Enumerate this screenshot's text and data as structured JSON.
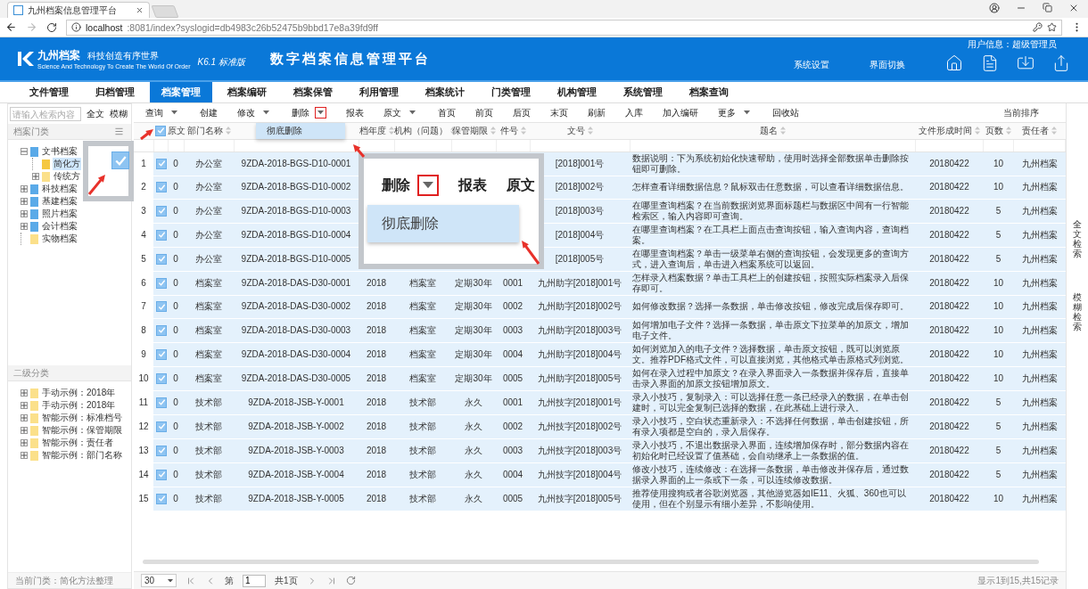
{
  "browser": {
    "tab_title": "九州档案信息管理平台",
    "url_host": "localhost",
    "url_path": ":8081/index?syslogid=db4983c26b52475b9bbd17e8a39fd9ff"
  },
  "header": {
    "logo_name": "九州档案",
    "logo_slogan": "科技创造有序世界",
    "logo_english": "Science And Technology To Create The World Of Order",
    "version": "K6.1 标准版",
    "title": "数字档案信息管理平台",
    "user_info": "用户信息：超级管理员",
    "links": [
      "系统设置",
      "界面切换"
    ]
  },
  "nav": [
    {
      "label": "文件管理",
      "selected": false
    },
    {
      "label": "归档管理",
      "selected": false
    },
    {
      "label": "档案管理",
      "selected": true
    },
    {
      "label": "档案编研",
      "selected": false
    },
    {
      "label": "档案保管",
      "selected": false
    },
    {
      "label": "利用管理",
      "selected": false
    },
    {
      "label": "档案统计",
      "selected": false
    },
    {
      "label": "门类管理",
      "selected": false
    },
    {
      "label": "机构管理",
      "selected": false
    },
    {
      "label": "系统管理",
      "selected": false
    },
    {
      "label": "档案查询",
      "selected": false
    }
  ],
  "search": {
    "placeholder": "请输入检索内容",
    "buttons": [
      "全文",
      "模糊"
    ]
  },
  "category_panel": {
    "title": "档案门类",
    "tree": [
      {
        "label": "文书档案",
        "color": "#5aaae8",
        "kind": "branch",
        "expanded": true,
        "selected": false,
        "children": [
          {
            "label": "简化方",
            "color": "#f5c842",
            "kind": "leaf",
            "selected": true
          },
          {
            "label": "传统方",
            "color": "#fbe08a",
            "kind": "branch",
            "expanded": false,
            "selected": false
          }
        ]
      },
      {
        "label": "科技档案",
        "color": "#5aaae8",
        "kind": "branch",
        "expanded": false,
        "selected": false
      },
      {
        "label": "基建档案",
        "color": "#5aaae8",
        "kind": "branch",
        "expanded": false,
        "selected": false
      },
      {
        "label": "照片档案",
        "color": "#5aaae8",
        "kind": "branch",
        "expanded": false,
        "selected": false
      },
      {
        "label": "会计档案",
        "color": "#5aaae8",
        "kind": "branch",
        "expanded": false,
        "selected": false
      },
      {
        "label": "实物档案",
        "color": "#fbe08a",
        "kind": "leaf",
        "selected": false
      }
    ]
  },
  "secondary_panel": {
    "title": "二级分类",
    "items": [
      {
        "label": "手动示例：2018年",
        "expanded": false
      },
      {
        "label": "手动示例：2018年",
        "expanded": false
      },
      {
        "label": "智能示例：标准档号",
        "expanded": false
      },
      {
        "label": "智能示例：保管期限",
        "expanded": false
      },
      {
        "label": "智能示例：责任者",
        "expanded": false
      },
      {
        "label": "智能示例：部门名称",
        "expanded": false
      }
    ]
  },
  "status": "当前门类：简化方法整理",
  "toolbar": [
    {
      "label": "查询",
      "dropdown": true,
      "highlighted": false
    },
    {
      "label": "创建",
      "dropdown": false,
      "highlighted": false
    },
    {
      "label": "修改",
      "dropdown": true,
      "highlighted": false
    },
    {
      "label": "删除",
      "dropdown": true,
      "highlighted": true
    },
    {
      "label": "报表",
      "dropdown": false,
      "highlighted": false
    },
    {
      "label": "原文",
      "dropdown": true,
      "highlighted": false
    },
    {
      "label": "首页",
      "dropdown": false,
      "highlighted": false
    },
    {
      "label": "前页",
      "dropdown": false,
      "highlighted": false
    },
    {
      "label": "后页",
      "dropdown": false,
      "highlighted": false
    },
    {
      "label": "末页",
      "dropdown": false,
      "highlighted": false
    },
    {
      "label": "刷新",
      "dropdown": false,
      "highlighted": false
    },
    {
      "label": "入库",
      "dropdown": false,
      "highlighted": false
    },
    {
      "label": "加入编研",
      "dropdown": false,
      "highlighted": false
    },
    {
      "label": "更多",
      "dropdown": true,
      "highlighted": false
    },
    {
      "label": "回收站",
      "dropdown": false,
      "highlighted": false
    }
  ],
  "sort_label": "当前排序",
  "delete_menu": {
    "items": [
      "彻底删除"
    ]
  },
  "table": {
    "all_checked": true,
    "columns": [
      {
        "label": "原文",
        "sortable": false
      },
      {
        "label": "部门名称",
        "sortable": true
      },
      null,
      {
        "label": "档年度",
        "sortable": true
      },
      {
        "label": "机构（问题）",
        "sortable": true
      },
      {
        "label": "保管期限",
        "sortable": true
      },
      {
        "label": "件号",
        "sortable": true
      },
      {
        "label": "文号",
        "sortable": true
      },
      {
        "label": "题名",
        "sortable": true
      },
      {
        "label": "文件形成时间",
        "sortable": true
      },
      {
        "label": "页数",
        "sortable": true
      },
      {
        "label": "责任者",
        "sortable": true
      }
    ],
    "rows": [
      {
        "number": "1",
        "checked": true,
        "cells": [
          "0",
          "办公室",
          "9ZDA-2018-BGS-D10-0001",
          null,
          null,
          null,
          null,
          "[2018]001号",
          "数据说明：下为系统初始化快速帮助，使用时选择全部数据单击删除按钮即可删除。",
          "20180422",
          "10",
          "九州档案"
        ]
      },
      {
        "number": "2",
        "checked": true,
        "cells": [
          "0",
          "办公室",
          "9ZDA-2018-BGS-D10-0002",
          null,
          null,
          null,
          null,
          "[2018]002号",
          "怎样查看详细数据信息？鼠标双击任意数据，可以查看详细数据信息。",
          "20180422",
          "10",
          "九州档案"
        ]
      },
      {
        "number": "3",
        "checked": true,
        "cells": [
          "0",
          "办公室",
          "9ZDA-2018-BGS-D10-0003",
          null,
          null,
          null,
          null,
          "[2018]003号",
          "在哪里查询档案？在当前数据浏览界面标题栏与数据区中间有一行智能检索区，输入内容即可查询。",
          "20180422",
          "5",
          "九州档案"
        ]
      },
      {
        "number": "4",
        "checked": true,
        "cells": [
          "0",
          "办公室",
          "9ZDA-2018-BGS-D10-0004",
          null,
          null,
          null,
          null,
          "[2018]004号",
          "在哪里查询档案？在工具栏上面点击查询按钮，输入查询内容，查询档案。",
          "20180422",
          "5",
          "九州档案"
        ]
      },
      {
        "number": "5",
        "checked": true,
        "cells": [
          "0",
          "办公室",
          "9ZDA-2018-BGS-D10-0005",
          null,
          null,
          null,
          null,
          "[2018]005号",
          "在哪里查询档案？单击一级菜单右侧的查询按钮，会发现更多的查询方式，进入查询后，单击进入档案系统可以返回。",
          "20180422",
          "5",
          "九州档案"
        ]
      },
      {
        "number": "6",
        "checked": true,
        "cells": [
          "0",
          "档案室",
          "9ZDA-2018-DAS-D30-0001",
          "2018",
          "档案室",
          "定期30年",
          "0001",
          "九州助字[2018]001号",
          "怎样录入档案数据？单击工具栏上的创建按钮，按照实际档案录入后保存即可。",
          "20180422",
          "10",
          "九州档案"
        ]
      },
      {
        "number": "7",
        "checked": true,
        "cells": [
          "0",
          "档案室",
          "9ZDA-2018-DAS-D30-0002",
          "2018",
          "档案室",
          "定期30年",
          "0002",
          "九州助字[2018]002号",
          "如何修改数据？选择一条数据，单击修改按钮，修改完成后保存即可。",
          "20180422",
          "10",
          "九州档案"
        ]
      },
      {
        "number": "8",
        "checked": true,
        "cells": [
          "0",
          "档案室",
          "9ZDA-2018-DAS-D30-0003",
          "2018",
          "档案室",
          "定期30年",
          "0003",
          "九州助字[2018]003号",
          "如何增加电子文件？选择一条数据，单击原文下拉菜单的加原文，增加电子文件。",
          "20180422",
          "10",
          "九州档案"
        ]
      },
      {
        "number": "9",
        "checked": true,
        "cells": [
          "0",
          "档案室",
          "9ZDA-2018-DAS-D30-0004",
          "2018",
          "档案室",
          "定期30年",
          "0004",
          "九州助字[2018]004号",
          "如何浏览加入的电子文件？选择数据，单击原文按钮，既可以浏览原文。推荐PDF格式文件，可以直接浏览，其他格式单击原格式列浏览。",
          "20180422",
          "10",
          "九州档案"
        ]
      },
      {
        "number": "10",
        "checked": true,
        "cells": [
          "0",
          "档案室",
          "9ZDA-2018-DAS-D30-0005",
          "2018",
          "档案室",
          "定期30年",
          "0005",
          "九州助字[2018]005号",
          "如何在录入过程中加原文？在录入界面录入一条数据并保存后，直接单击录入界面的加原文按钮增加原文。",
          "20180422",
          "10",
          "九州档案"
        ]
      },
      {
        "number": "11",
        "checked": true,
        "cells": [
          "0",
          "技术部",
          "9ZDA-2018-JSB-Y-0001",
          "2018",
          "技术部",
          "永久",
          "0001",
          "九州技字[2018]001号",
          "录入小技巧，复制录入：可以选择任意一条已经录入的数据，在单击创建时，可以完全复制已选择的数据，在此基础上进行录入。",
          "20180422",
          "5",
          "九州档案"
        ]
      },
      {
        "number": "12",
        "checked": true,
        "cells": [
          "0",
          "技术部",
          "9ZDA-2018-JSB-Y-0002",
          "2018",
          "技术部",
          "永久",
          "0002",
          "九州技字[2018]002号",
          "录入小技巧，空白状态重新录入：不选择任何数据，单击创建按钮，所有录入项都是空白的，录入后保存。",
          "20180422",
          "5",
          "九州档案"
        ]
      },
      {
        "number": "13",
        "checked": true,
        "cells": [
          "0",
          "技术部",
          "9ZDA-2018-JSB-Y-0003",
          "2018",
          "技术部",
          "永久",
          "0003",
          "九州技字[2018]003号",
          "录入小技巧，不退出数据录入界面，连续增加保存时，部分数据内容在初始化时已经设置了值基础，会自动继承上一条数据的值。",
          "20180422",
          "5",
          "九州档案"
        ]
      },
      {
        "number": "14",
        "checked": true,
        "cells": [
          "0",
          "技术部",
          "9ZDA-2018-JSB-Y-0004",
          "2018",
          "技术部",
          "永久",
          "0004",
          "九州技字[2018]004号",
          "修改小技巧，连续修改：在选择一条数据，单击修改并保存后，通过数据录入界面的上一条或下一条，可以连续修改数据。",
          "20180422",
          "5",
          "九州档案"
        ]
      },
      {
        "number": "15",
        "checked": true,
        "cells": [
          "0",
          "技术部",
          "9ZDA-2018-JSB-Y-0005",
          "2018",
          "技术部",
          "永久",
          "0005",
          "九州技字[2018]005号",
          "推荐使用搜狗或者谷歌浏览器，其他游览器如IE11、火狐、360也可以使用，但在个别显示有细小差异，不影响使用。",
          "20180422",
          "10",
          "九州档案"
        ]
      }
    ]
  },
  "pager": {
    "page_size": "30",
    "page_prefix": "第",
    "page": "1",
    "page_suffix": "共1页",
    "summary": "显示1到15,共15记录"
  },
  "side_tabs": [
    "全文检索",
    "模糊检索"
  ],
  "callouts": [
    {
      "kind": "checkbox",
      "checked": true
    },
    {
      "kind": "menu",
      "labels": [
        "删除",
        "报表",
        "原文"
      ],
      "caret_highlighted": true,
      "menu_item": "彻底删除"
    }
  ]
}
